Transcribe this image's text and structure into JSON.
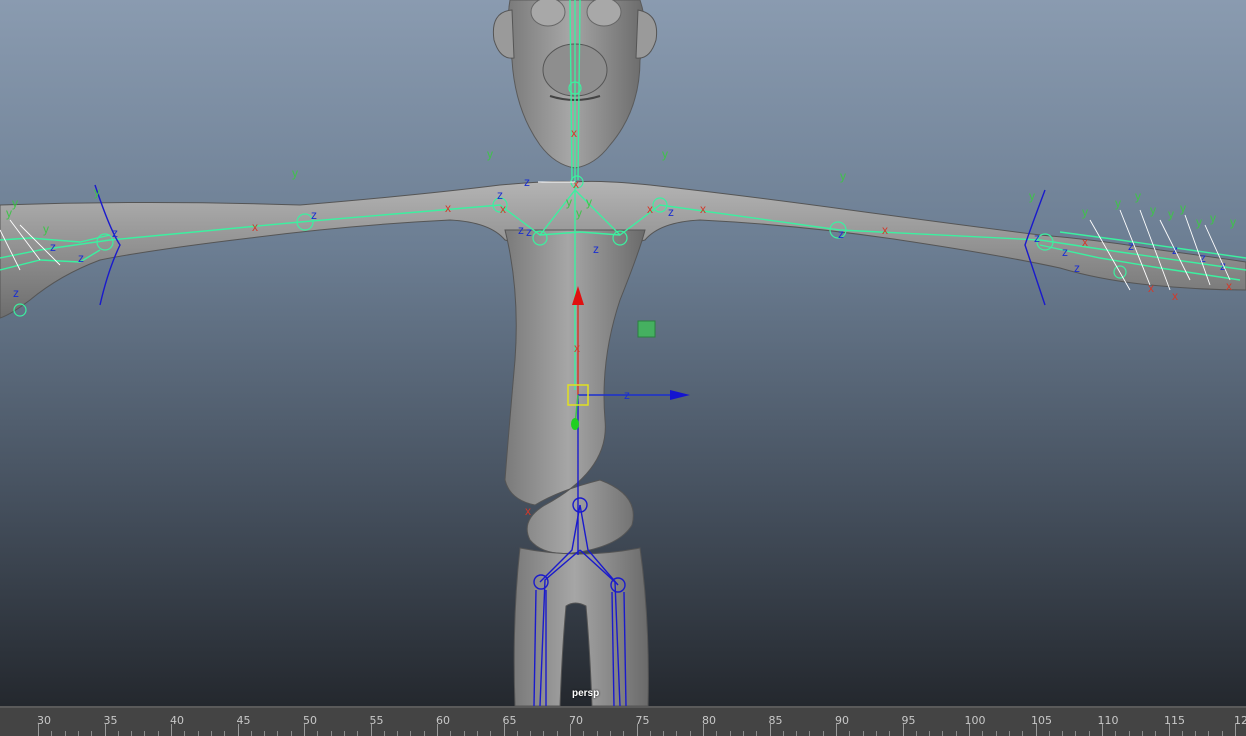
{
  "viewport": {
    "camera_label": "persp",
    "background_top": "#8a9bb0",
    "background_bottom": "#24282e",
    "axis_colors": {
      "x": "#d23a2a",
      "y": "#3fc24a",
      "z": "#1b2fd0"
    },
    "joint_color": "#3cf0a0",
    "skeleton_color": "#1a1acc"
  },
  "manipulator": {
    "icon": "move-tool-manipulator",
    "axis_labels": [
      "x",
      "z"
    ]
  },
  "time_slider": {
    "frames": [
      "30",
      "35",
      "40",
      "45",
      "50",
      "55",
      "60",
      "65",
      "70",
      "75",
      "80",
      "85",
      "90",
      "95",
      "100",
      "105",
      "110",
      "115",
      "12"
    ]
  }
}
